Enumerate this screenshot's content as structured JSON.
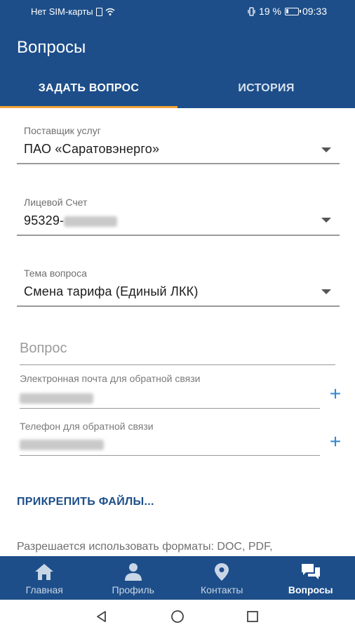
{
  "status_bar": {
    "carrier": "Нет SIM-карты",
    "battery": "19 %",
    "time": "09:33",
    "battery_level": 0.19
  },
  "app_bar": {
    "title": "Вопросы"
  },
  "tabs": [
    {
      "label": "ЗАДАТЬ ВОПРОС",
      "active": true
    },
    {
      "label": "ИСТОРИЯ",
      "active": false
    }
  ],
  "form": {
    "provider": {
      "label": "Поставщик услуг",
      "value": "ПАО «Саратовэнерго»"
    },
    "account": {
      "label": "Лицевой Счет",
      "value": "95329-"
    },
    "topic": {
      "label": "Тема вопроса",
      "value": "Смена тарифа (Единый ЛКК)"
    },
    "question": {
      "placeholder": "Вопрос"
    },
    "email": {
      "label": "Электронная почта для обратной связи"
    },
    "phone": {
      "label": "Телефон для обратной связи"
    },
    "attach_label": "ПРИКРЕПИТЬ ФАЙЛЫ...",
    "formats_text": "Разрешается использовать форматы: DOC, PDF,"
  },
  "bottom_nav": [
    {
      "label": "Главная",
      "icon": "home-icon",
      "active": false
    },
    {
      "label": "Профиль",
      "icon": "profile-icon",
      "active": false
    },
    {
      "label": "Контакты",
      "icon": "location-pin-icon",
      "active": false
    },
    {
      "label": "Вопросы",
      "icon": "chat-bubbles-icon",
      "active": true
    }
  ],
  "system_nav": {
    "icons": [
      "back-icon",
      "home-circle-icon",
      "recents-square-icon"
    ]
  },
  "colors": {
    "primary": "#1d4e89",
    "accent": "#f2a33a",
    "plus": "#2f86d6"
  }
}
